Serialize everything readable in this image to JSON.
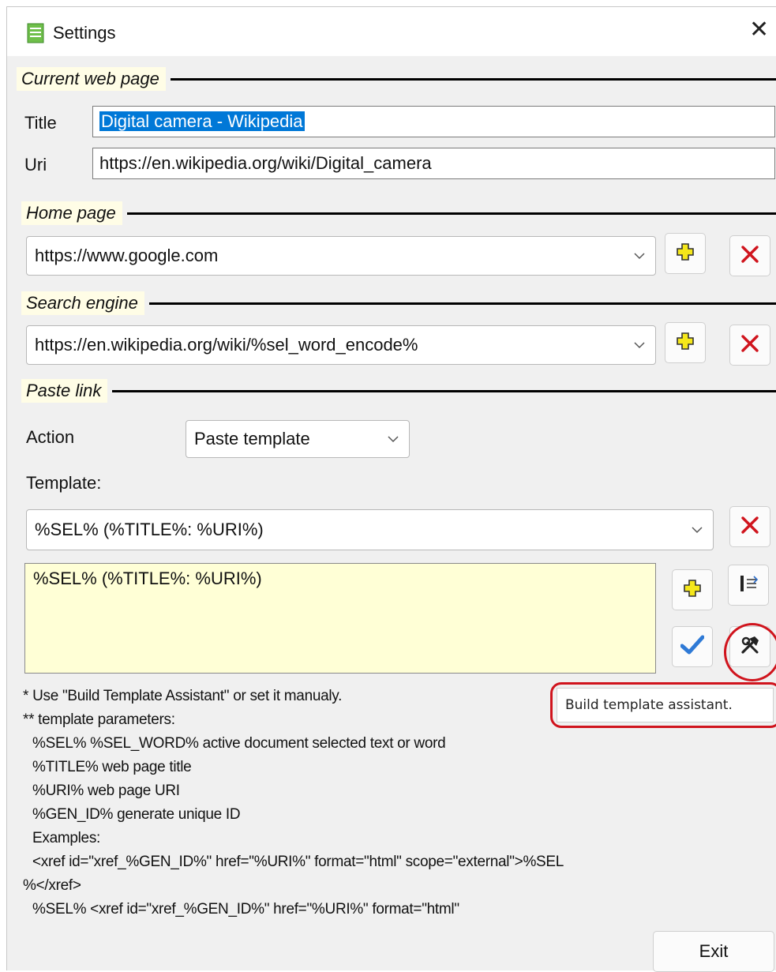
{
  "window": {
    "title": "Settings",
    "icon": "document-icon",
    "close_glyph": "✕"
  },
  "current_page": {
    "section_label": "Current web page",
    "title_label": "Title",
    "title_value": "Digital camera - Wikipedia",
    "uri_label": "Uri",
    "uri_value": "https://en.wikipedia.org/wiki/Digital_camera"
  },
  "home_page": {
    "section_label": "Home page",
    "selected": "https://www.google.com",
    "add_icon": "plus-icon",
    "delete_icon": "delete-x-icon"
  },
  "search_engine": {
    "section_label": "Search engine",
    "selected": "https://en.wikipedia.org/wiki/%sel_word_encode%",
    "add_icon": "plus-icon",
    "delete_icon": "delete-x-icon"
  },
  "paste_link": {
    "section_label": "Paste link",
    "action_label": "Action",
    "action_selected": "Paste template",
    "template_label": "Template:",
    "template_selected": "%SEL% (%TITLE%: %URI%)",
    "template_text": "%SEL% (%TITLE%: %URI%)"
  },
  "tooltip": {
    "text": "Build template assistant."
  },
  "help_lines": [
    "* Use \"Build Template Assistant\"  or set it manualy.",
    "** template parameters:",
    "  %SEL% %SEL_WORD% active document selected text or word",
    "  %TITLE% web page title",
    "  %URI% web page URI",
    "  %GEN_ID% generate unique ID",
    "  Examples:",
    "  <xref id=\"xref_%GEN_ID%\" href=\"%URI%\" format=\"html\" scope=\"external\">%SEL",
    "%</xref>",
    "  %SEL% <xref id=\"xref_%GEN_ID%\" href=\"%URI%\" format=\"html\""
  ],
  "exit_label": "Exit",
  "colors": {
    "accent_red": "#d0141d",
    "memo_bg": "#ffffd6",
    "section_label_bg": "#fffde6",
    "selection_blue": "#0078d7"
  }
}
